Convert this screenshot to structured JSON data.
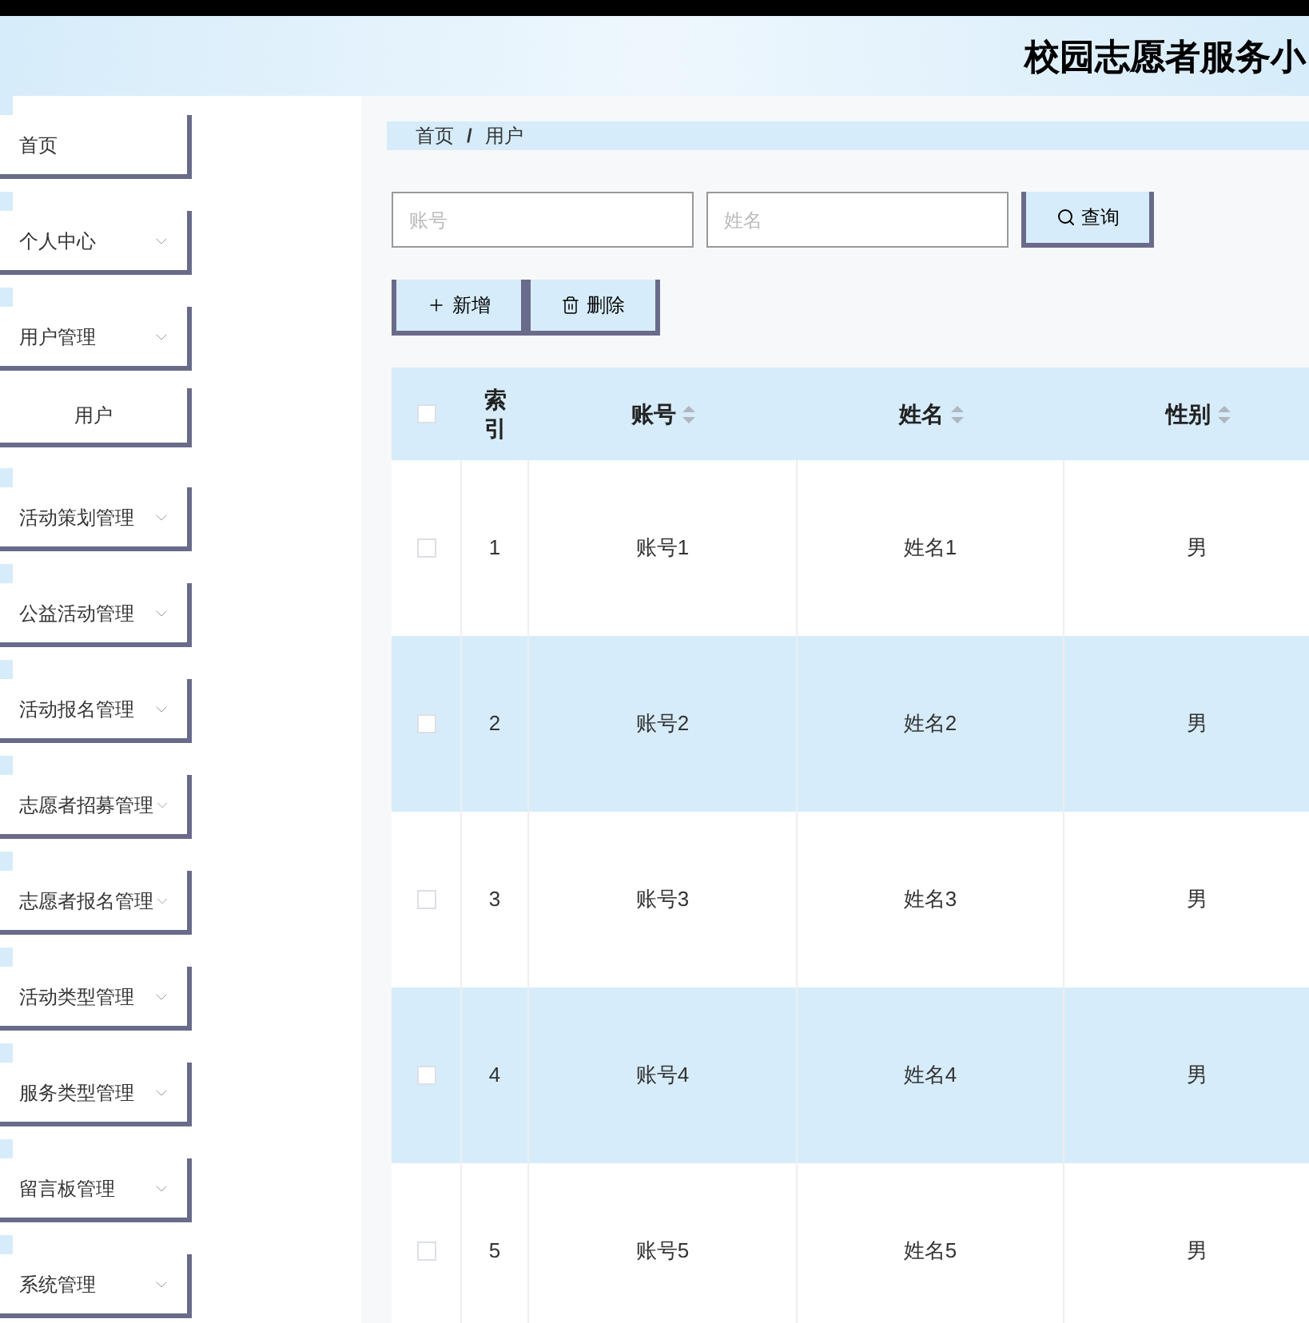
{
  "header": {
    "title": "校园志愿者服务小"
  },
  "sidebar": {
    "items": [
      {
        "label": "首页",
        "kind": "link"
      },
      {
        "label": "个人中心",
        "kind": "submenu"
      },
      {
        "label": "用户管理",
        "kind": "submenu"
      },
      {
        "label": "用户",
        "kind": "child"
      },
      {
        "label": "活动策划管理",
        "kind": "submenu"
      },
      {
        "label": "公益活动管理",
        "kind": "submenu"
      },
      {
        "label": "活动报名管理",
        "kind": "submenu"
      },
      {
        "label": "志愿者招募管理",
        "kind": "submenu"
      },
      {
        "label": "志愿者报名管理",
        "kind": "submenu"
      },
      {
        "label": "活动类型管理",
        "kind": "submenu"
      },
      {
        "label": "服务类型管理",
        "kind": "submenu"
      },
      {
        "label": "留言板管理",
        "kind": "submenu"
      },
      {
        "label": "系统管理",
        "kind": "submenu"
      }
    ]
  },
  "breadcrumb": {
    "items": [
      "首页",
      "用户"
    ],
    "separator": "/"
  },
  "search": {
    "fields": [
      {
        "placeholder": "账号"
      },
      {
        "placeholder": "姓名"
      }
    ],
    "button": "查询"
  },
  "actions": [
    {
      "label": "新增",
      "kind": "add"
    },
    {
      "label": "删除",
      "kind": "delete"
    }
  ],
  "table": {
    "all_checked": false,
    "columns": [
      {
        "label": "索引",
        "sortable": false
      },
      {
        "label": "账号",
        "sortable": true
      },
      {
        "label": "姓名",
        "sortable": true
      },
      {
        "label": "性别",
        "sortable": true
      }
    ],
    "rows": [
      {
        "checked": false,
        "cells": [
          "1",
          "账号1",
          "姓名1",
          "男"
        ]
      },
      {
        "checked": false,
        "cells": [
          "2",
          "账号2",
          "姓名2",
          "男"
        ]
      },
      {
        "checked": false,
        "cells": [
          "3",
          "账号3",
          "姓名3",
          "男"
        ]
      },
      {
        "checked": false,
        "cells": [
          "4",
          "账号4",
          "姓名4",
          "男"
        ]
      },
      {
        "checked": false,
        "cells": [
          "5",
          "账号5",
          "姓名5",
          "男"
        ]
      }
    ]
  }
}
